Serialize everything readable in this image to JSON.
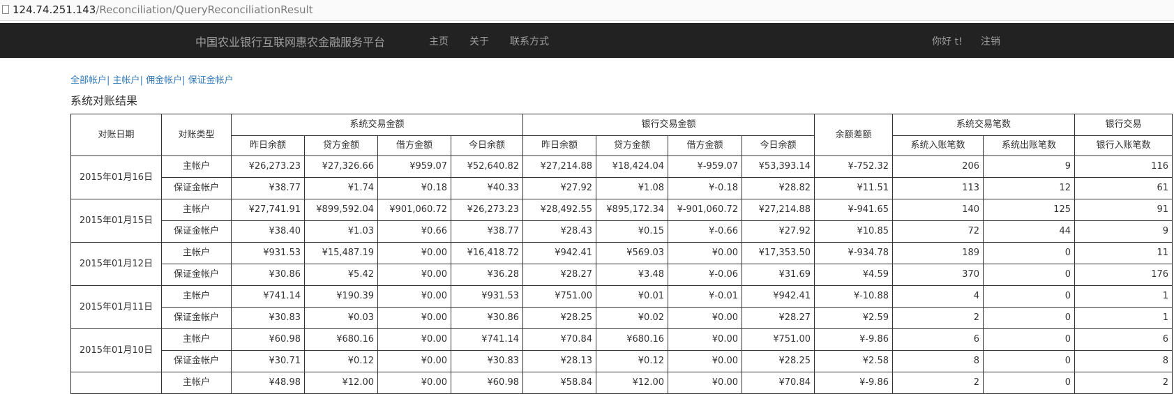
{
  "browser": {
    "url_host": "124.74.251.143",
    "url_path": "/Reconciliation/QueryReconciliationResult"
  },
  "navbar": {
    "brand": "中国农业银行互联网惠农金融服务平台",
    "home": "主页",
    "about": "关于",
    "contact": "联系方式",
    "greeting": "你好 t!",
    "logout": "注销"
  },
  "account_links": {
    "all": "全部帐户",
    "main": "主帐户",
    "commission": "佣金帐户",
    "deposit": "保证金帐户",
    "separator": "|"
  },
  "page_title": "系统对账结果",
  "table": {
    "headers": {
      "date": "对账日期",
      "type": "对账类型",
      "sys_amount_group": "系统交易金额",
      "bank_amount_group": "银行交易金额",
      "balance_diff": "余额差额",
      "sys_count_group": "系统交易笔数",
      "bank_count_group": "银行交易",
      "prev_balance": "昨日余额",
      "credit": "贷方金额",
      "debit": "借方金额",
      "today_balance": "今日余额",
      "sys_in_count": "系统入账笔数",
      "sys_out_count": "系统出账笔数",
      "bank_in_count": "银行入账笔数"
    },
    "groups": [
      {
        "date": "2015年01月16日",
        "rows": [
          {
            "type": "主帐户",
            "cells": [
              "¥26,273.23",
              "¥27,326.66",
              "¥959.07",
              "¥52,640.82",
              "¥27,214.88",
              "¥18,424.04",
              "¥-959.07",
              "¥53,393.14",
              "¥-752.32",
              "206",
              "9",
              "116"
            ]
          },
          {
            "type": "保证金帐户",
            "cells": [
              "¥38.77",
              "¥1.74",
              "¥0.18",
              "¥40.33",
              "¥27.92",
              "¥1.08",
              "¥-0.18",
              "¥28.82",
              "¥11.51",
              "113",
              "12",
              "61"
            ]
          }
        ]
      },
      {
        "date": "2015年01月15日",
        "rows": [
          {
            "type": "主帐户",
            "cells": [
              "¥27,741.91",
              "¥899,592.04",
              "¥901,060.72",
              "¥26,273.23",
              "¥28,492.55",
              "¥895,172.34",
              "¥-901,060.72",
              "¥27,214.88",
              "¥-941.65",
              "140",
              "125",
              "91"
            ]
          },
          {
            "type": "保证金帐户",
            "cells": [
              "¥38.40",
              "¥1.03",
              "¥0.66",
              "¥38.77",
              "¥28.43",
              "¥0.15",
              "¥-0.66",
              "¥27.92",
              "¥10.85",
              "72",
              "44",
              "9"
            ]
          }
        ]
      },
      {
        "date": "2015年01月12日",
        "rows": [
          {
            "type": "主帐户",
            "cells": [
              "¥931.53",
              "¥15,487.19",
              "¥0.00",
              "¥16,418.72",
              "¥942.41",
              "¥569.03",
              "¥0.00",
              "¥17,353.50",
              "¥-934.78",
              "189",
              "0",
              "11"
            ]
          },
          {
            "type": "保证金帐户",
            "cells": [
              "¥30.86",
              "¥5.42",
              "¥0.00",
              "¥36.28",
              "¥28.27",
              "¥3.48",
              "¥-0.06",
              "¥31.69",
              "¥4.59",
              "370",
              "0",
              "176"
            ]
          }
        ]
      },
      {
        "date": "2015年01月11日",
        "rows": [
          {
            "type": "主帐户",
            "cells": [
              "¥741.14",
              "¥190.39",
              "¥0.00",
              "¥931.53",
              "¥751.00",
              "¥0.01",
              "¥-0.01",
              "¥942.41",
              "¥-10.88",
              "4",
              "0",
              "1"
            ]
          },
          {
            "type": "保证金帐户",
            "cells": [
              "¥30.83",
              "¥0.03",
              "¥0.00",
              "¥30.86",
              "¥28.25",
              "¥0.02",
              "¥0.00",
              "¥28.27",
              "¥2.59",
              "2",
              "0",
              "1"
            ]
          }
        ]
      },
      {
        "date": "2015年01月10日",
        "rows": [
          {
            "type": "主帐户",
            "cells": [
              "¥60.98",
              "¥680.16",
              "¥0.00",
              "¥741.14",
              "¥70.84",
              "¥680.16",
              "¥0.00",
              "¥751.00",
              "¥-9.86",
              "6",
              "0",
              "6"
            ]
          },
          {
            "type": "保证金帐户",
            "cells": [
              "¥30.71",
              "¥0.12",
              "¥0.00",
              "¥30.83",
              "¥28.13",
              "¥0.12",
              "¥0.00",
              "¥28.25",
              "¥2.58",
              "8",
              "0",
              "8"
            ]
          }
        ]
      },
      {
        "date": "",
        "rows": [
          {
            "type": "主帐户",
            "cells": [
              "¥48.98",
              "¥12.00",
              "¥0.00",
              "¥60.98",
              "¥58.84",
              "¥12.00",
              "¥0.00",
              "¥70.84",
              "¥-9.86",
              "2",
              "0",
              "2"
            ]
          }
        ]
      }
    ]
  }
}
